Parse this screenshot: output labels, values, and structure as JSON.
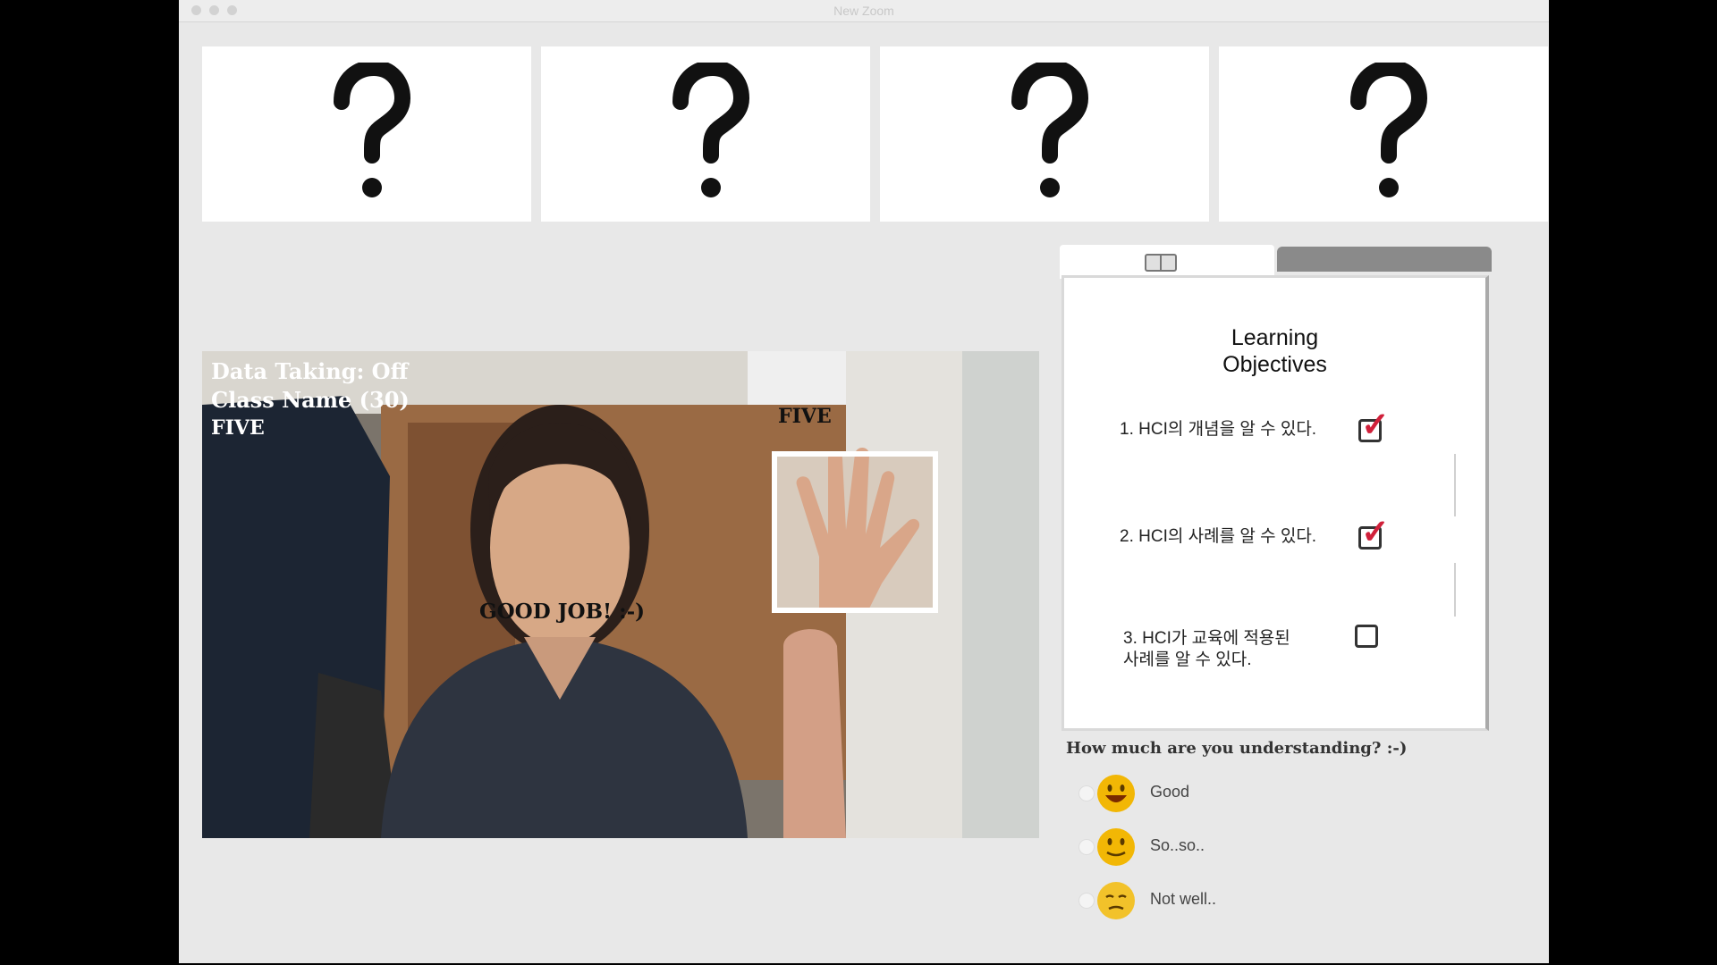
{
  "window": {
    "title": "New Zoom"
  },
  "question_cards": [
    "?",
    "?",
    "?",
    "?"
  ],
  "video": {
    "overlay_line1": "Data Taking: Off",
    "overlay_line2": "Class Name (30)",
    "overlay_line3": "FIVE",
    "gesture_label": "FIVE",
    "feedback_text": "GOOD JOB! :-)"
  },
  "panel": {
    "title_line1": "Learning",
    "title_line2": "Objectives",
    "objectives": [
      {
        "text_line1": "1. HCI의 개념을 알 수 있다.",
        "text_line2": "",
        "checked": true
      },
      {
        "text_line1": "2. HCI의 사례를 알 수 있다.",
        "text_line2": "",
        "checked": true
      },
      {
        "text_line1": "3. HCI가 교육에 적용된",
        "text_line2": "사례를 알 수 있다.",
        "checked": false
      }
    ]
  },
  "understanding": {
    "question": "How much are you understanding? :-)",
    "options": [
      "Good",
      "So..so..",
      "Not well.."
    ]
  },
  "colors": {
    "check": "#d0203a",
    "emoji": "#f2b705"
  }
}
